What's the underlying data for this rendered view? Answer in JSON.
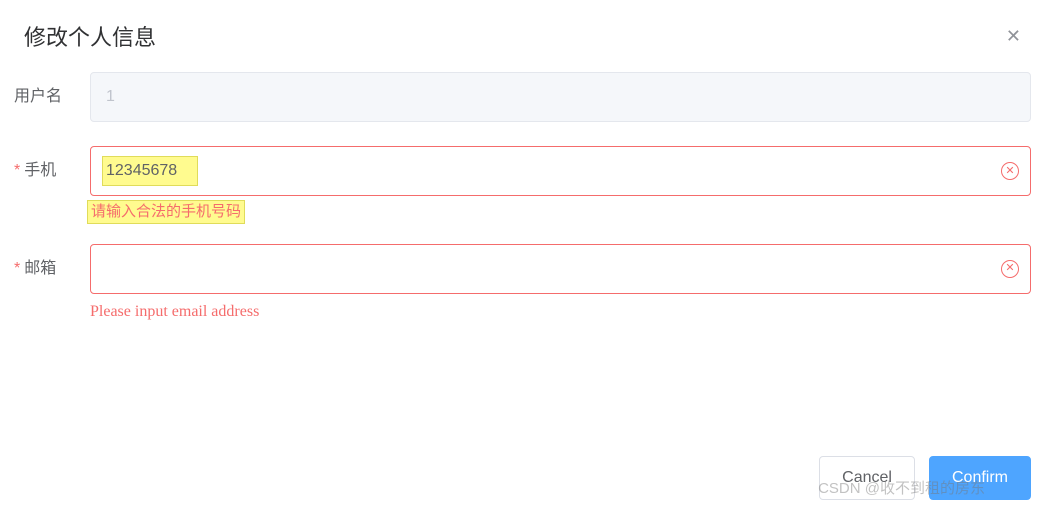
{
  "dialog": {
    "title": "修改个人信息"
  },
  "form": {
    "username": {
      "label": "用户名",
      "value": "1"
    },
    "phone": {
      "label": "手机",
      "value": "12345678",
      "error": "请输入合法的手机号码"
    },
    "email": {
      "label": "邮箱",
      "value": "",
      "error": "Please input email address"
    }
  },
  "footer": {
    "cancel": "Cancel",
    "confirm": "Confirm"
  },
  "watermark": "CSDN @收不到租的房东"
}
